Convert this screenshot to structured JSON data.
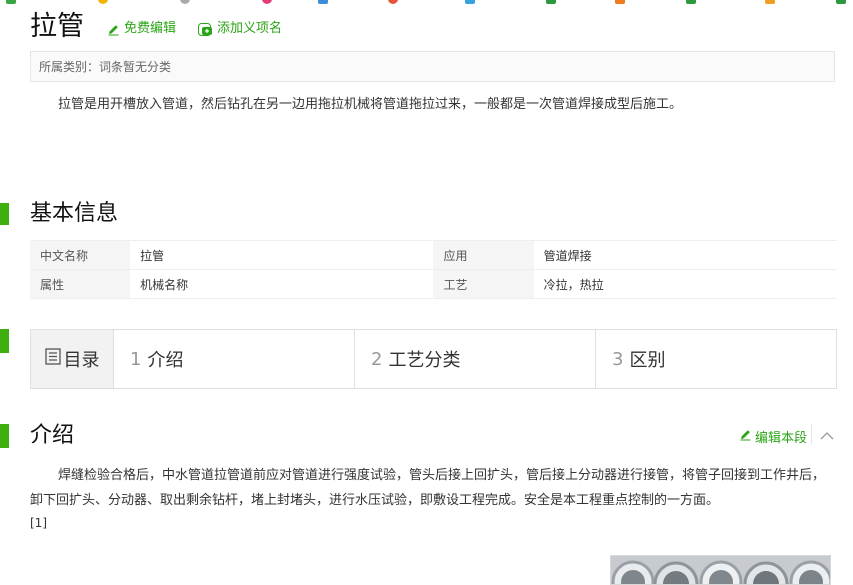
{
  "page": {
    "title": "拉管",
    "actions": {
      "free_edit": "免费编辑",
      "add_meaning": "添加义项名"
    },
    "category": {
      "label": "所属类别：",
      "value": "词条暂无分类"
    },
    "summary": "拉管是用开槽放入管道，然后钻孔在另一边用拖拉机械将管道拖拉过来，一般都是一次管道焊接成型后施工。"
  },
  "basic_info": {
    "heading": "基本信息",
    "rows": [
      {
        "k1": "中文名称",
        "v1": "拉管",
        "k2": "应用",
        "v2": "管道焊接"
      },
      {
        "k1": "属性",
        "v1": "机械名称",
        "k2": "工艺",
        "v2": "冷拉，热拉"
      }
    ]
  },
  "toc": {
    "label": "目录",
    "items": [
      {
        "num": "1",
        "label": "介绍"
      },
      {
        "num": "2",
        "label": "工艺分类"
      },
      {
        "num": "3",
        "label": "区别"
      }
    ]
  },
  "intro": {
    "heading": "介绍",
    "edit_label": "编辑本段",
    "paragraph": "焊缝检验合格后，中水管道拉管道前应对管道进行强度试验，管头后接上回扩头，管后接上分动器进行接管，将管子回接到工作井后，卸下回扩头、分动器、取出剩余钻杆，堵上封堵头，进行水压试验，即敷设工程完成。安全是本工程重点控制的一方面。",
    "ref": "[1]"
  },
  "colors": {
    "accent": "#3eaf0e",
    "link": "#2aa515"
  },
  "icons": {
    "edit": "pencil-icon",
    "add": "add-meaning-icon",
    "toc": "list-icon",
    "collapse": "chevron-up-icon"
  }
}
